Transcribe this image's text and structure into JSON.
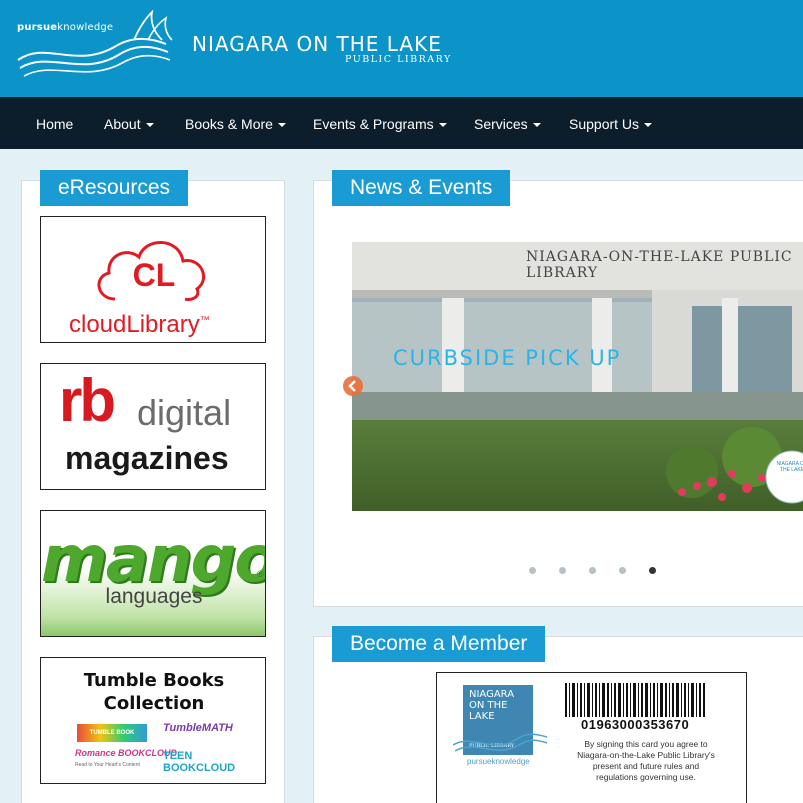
{
  "header": {
    "brand_small_bold": "pursue",
    "brand_small_rest": "knowledge",
    "library_name": "NIAGARA ON THE LAKE",
    "library_sub": "PUBLIC LIBRARY"
  },
  "nav": {
    "items": [
      {
        "label": "Home",
        "dropdown": false
      },
      {
        "label": "About",
        "dropdown": true
      },
      {
        "label": "Books & More",
        "dropdown": true
      },
      {
        "label": "Events & Programs",
        "dropdown": true
      },
      {
        "label": "Services",
        "dropdown": true
      },
      {
        "label": "Support Us",
        "dropdown": true
      }
    ]
  },
  "eresources": {
    "title": "eResources",
    "cloudlibrary": {
      "badge": "CL",
      "name": "cloudLibrary",
      "tm": "™"
    },
    "rbdigital": {
      "badge": "rb",
      "line1": "digital",
      "line2": "magazines"
    },
    "mango": {
      "name": "mango",
      "sub": "languages",
      "reg": "®"
    },
    "tumblebooks": {
      "line1": "Tumble Books",
      "line2": "Collection",
      "b1": "TUMBLE BOOK LIBRARY",
      "b2": "TumbleMATH",
      "b3": "Romance BOOKCLOUD",
      "b3_tag": "Read to Your Heart's Content",
      "b4": "TEEN BOOKCLOUD"
    }
  },
  "news": {
    "title": "News & Events",
    "slide": {
      "building_sign": "NIAGARA-ON-THE-LAKE PUBLIC LIBRARY",
      "caption": "CURBSIDE PICK UP",
      "badge": "NIAGARA ON THE LAKE"
    },
    "dots": 5,
    "active_dot": 4
  },
  "member": {
    "title": "Become a Member",
    "card": {
      "logo_l1": "NIAGARA",
      "logo_l2": "ON THE",
      "logo_l3": "LAKE",
      "logo_sub": "PUBLIC LIBRARY",
      "logo_tag": "pursueknowledge",
      "barcode_number": "01963000353670",
      "terms": "By signing this card you agree to Niagara-on-the-Lake Public Library's present and future rules and regulations governing use."
    }
  },
  "colors": {
    "header": "#0c94c9",
    "nav": "#0c1d2b",
    "tab": "#1a9bd3",
    "page": "#e3f0f6"
  }
}
